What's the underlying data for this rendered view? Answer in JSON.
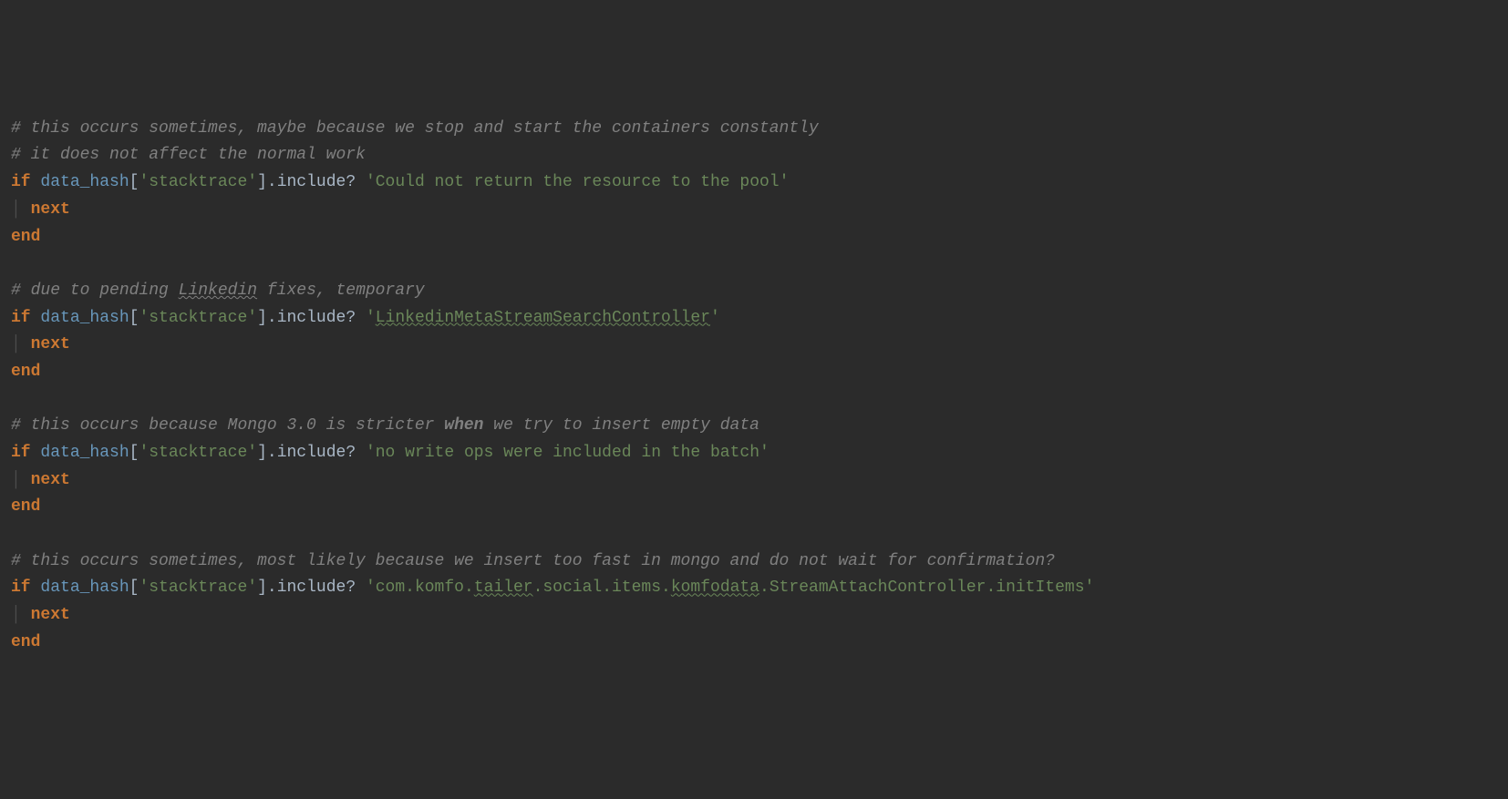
{
  "code": {
    "block1": {
      "comment1": "# this occurs sometimes, maybe because we stop and start the containers constantly",
      "comment2": "# it does not affect the normal work",
      "if": "if",
      "identifier": "data_hash",
      "lbracket": "[",
      "key": "'stacktrace'",
      "rbracket": "]",
      "dot": ".",
      "method": "include?",
      "space": " ",
      "string": "'Could not return the resource to the pool'",
      "next": "next",
      "end": "end"
    },
    "block2": {
      "comment1_a": "# due to pending ",
      "comment1_b": "Linkedin",
      "comment1_c": " fixes, temporary",
      "if": "if",
      "identifier": "data_hash",
      "lbracket": "[",
      "key": "'stacktrace'",
      "rbracket": "]",
      "dot": ".",
      "method": "include?",
      "space": " ",
      "string_a": "'",
      "string_b": "LinkedinMetaStreamSearchController",
      "string_c": "'",
      "next": "next",
      "end": "end"
    },
    "block3": {
      "comment1_a": "# this occurs because Mongo 3.0 is stricter ",
      "comment1_b": "when",
      "comment1_c": " we try to insert empty data",
      "if": "if",
      "identifier": "data_hash",
      "lbracket": "[",
      "key": "'stacktrace'",
      "rbracket": "]",
      "dot": ".",
      "method": "include?",
      "space": " ",
      "string": "'no write ops were included in the batch'",
      "next": "next",
      "end": "end"
    },
    "block4": {
      "comment1": "# this occurs sometimes, most likely because we insert too fast in mongo and do not wait for confirmation?",
      "if": "if",
      "identifier": "data_hash",
      "lbracket": "[",
      "key": "'stacktrace'",
      "rbracket": "]",
      "dot": ".",
      "method": "include?",
      "space": " ",
      "string_a": "'com.komfo.",
      "string_b": "tailer",
      "string_c": ".social.items.",
      "string_d": "komfodata",
      "string_e": ".StreamAttachController.initItems'",
      "next": "next",
      "end": "end"
    },
    "indent_guide": "  ",
    "pipe": "│ "
  }
}
